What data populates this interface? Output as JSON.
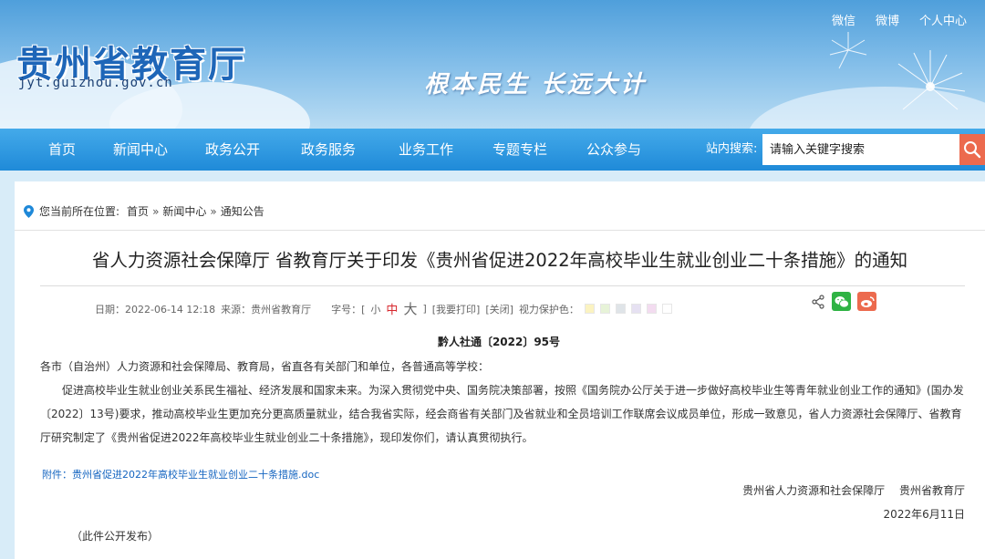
{
  "site": {
    "title": "贵州省教育厅",
    "url": "jyt.guizhou.gov.cn",
    "slogan": "根本民生 长远大计"
  },
  "top_links": [
    "微信",
    "微博",
    "个人中心"
  ],
  "nav": {
    "items": [
      "首页",
      "新闻中心",
      "政务公开",
      "政务服务",
      "业务工作",
      "专题专栏",
      "公众参与"
    ],
    "search_label": "站内搜索:",
    "search_placeholder": "请输入关键字搜索"
  },
  "breadcrumb": {
    "prefix": "您当前所在位置:",
    "items": [
      "首页",
      "新闻中心",
      "通知公告"
    ],
    "separator": "»"
  },
  "article": {
    "title": "省人力资源社会保障厅 省教育厅关于印发《贵州省促进2022年高校毕业生就业创业二十条措施》的通知",
    "meta": {
      "date": "日期：2022-06-14 12:18",
      "source": "来源：贵州省教育厅",
      "font_label": "字号：[",
      "font_small": "小",
      "font_mid": "中",
      "font_large": "大",
      "font_close": "]",
      "print": "[我要打印]",
      "close": "[关闭]",
      "eye_label": "视力保护色：",
      "eye_colors": [
        "#fbf3c1",
        "#e7f3d8",
        "#dfe4e8",
        "#e6e1f2",
        "#f3dcf0",
        "#ffffff"
      ]
    },
    "doc_number": "黔人社通〔2022〕95号",
    "salutation": "各市（自治州）人力资源和社会保障局、教育局，省直各有关部门和单位，各普通高等学校：",
    "paragraph": "促进高校毕业生就业创业关系民生福祉、经济发展和国家未来。为深入贯彻党中央、国务院决策部署，按照《国务院办公厅关于进一步做好高校毕业生等青年就业创业工作的通知》(国办发〔2022〕13号)要求，推动高校毕业生更加充分更高质量就业，结合我省实际，经会商省有关部门及省就业和全员培训工作联席会议成员单位，形成一致意见，省人力资源社会保障厅、省教育厅研究制定了《贵州省促进2022年高校毕业生就业创业二十条措施》，现印发你们，请认真贯彻执行。",
    "attachment": "附件：贵州省促进2022年高校毕业生就业创业二十条措施.doc",
    "signature_org": "贵州省人力资源和社会保障厅　 贵州省教育厅",
    "signature_date": "2022年6月11日",
    "footnote": "（此件公开发布）"
  },
  "colors": {
    "nav_bg": "#2b96e0",
    "search_button": "#ec6a4e",
    "wechat": "#2fb344",
    "weibo": "#ec6a4e",
    "link": "#1565c0"
  }
}
